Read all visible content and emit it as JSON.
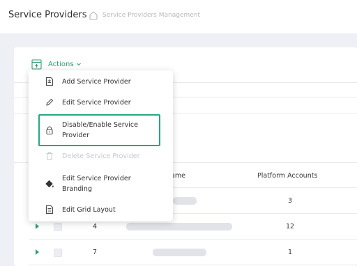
{
  "header": {
    "title": "Service Providers",
    "breadcrumb": "Service Providers Management",
    "icons": {
      "home": "home-icon"
    }
  },
  "toolbar": {
    "actions_label": "Actions",
    "icons": {
      "actions": "grid-add-icon",
      "chevron": "chevron-down-icon"
    }
  },
  "menu": {
    "items": [
      {
        "label": "Add Service Provider",
        "icon": "add-document-icon",
        "enabled": true
      },
      {
        "label": "Edit Service Provider",
        "icon": "pencil-icon",
        "enabled": true
      },
      {
        "label_line1": "Disable/Enable Service",
        "label_line2": "Provider",
        "icon": "lock-icon",
        "enabled": true,
        "highlighted": true
      },
      {
        "label": "Delete Service Provider",
        "icon": "trash-icon",
        "enabled": false
      },
      {
        "label_line1": "Edit Service Provider",
        "label_line2": "Branding",
        "icon": "paint-bucket-icon",
        "enabled": true
      },
      {
        "label": "Edit Grid Layout",
        "icon": "document-list-icon",
        "enabled": true
      }
    ]
  },
  "table": {
    "columns": {
      "name": "ame",
      "platform_accounts": "Platform Accounts"
    },
    "rows": [
      {
        "id": "",
        "platform_accounts": "3"
      },
      {
        "id": "4",
        "platform_accounts": "12"
      },
      {
        "id": "7",
        "platform_accounts": "1"
      }
    ]
  },
  "colors": {
    "accent": "#2e9d6c",
    "highlight": "#24a97a",
    "background": "#eef0f6"
  }
}
